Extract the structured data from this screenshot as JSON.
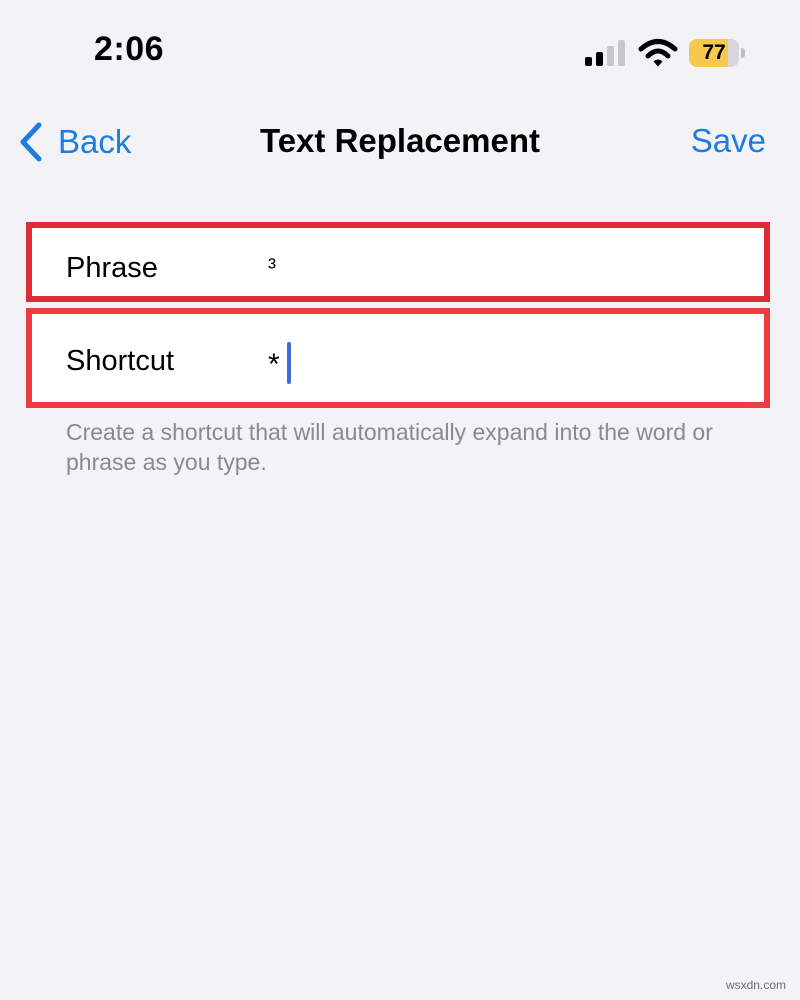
{
  "status_bar": {
    "time": "2:06",
    "battery_level": "77",
    "battery_percent": 77,
    "signal_icon": "cellular-signal-icon",
    "wifi_icon": "wifi-icon"
  },
  "nav": {
    "back_label": "Back",
    "back_icon": "chevron-left-icon",
    "title": "Text Replacement",
    "save_label": "Save"
  },
  "form": {
    "phrase_label": "Phrase",
    "phrase_value": "³",
    "shortcut_label": "Shortcut",
    "shortcut_value": "*"
  },
  "hint": "Create a shortcut that will automatically expand into the word or phrase as you type.",
  "watermark": "wsxdn.com",
  "colors": {
    "accent": "#1c7ce0",
    "highlight_box": "#e8343a",
    "background": "#f2f2f7",
    "battery": "#f6c94c",
    "cursor": "#3c6bd6"
  }
}
